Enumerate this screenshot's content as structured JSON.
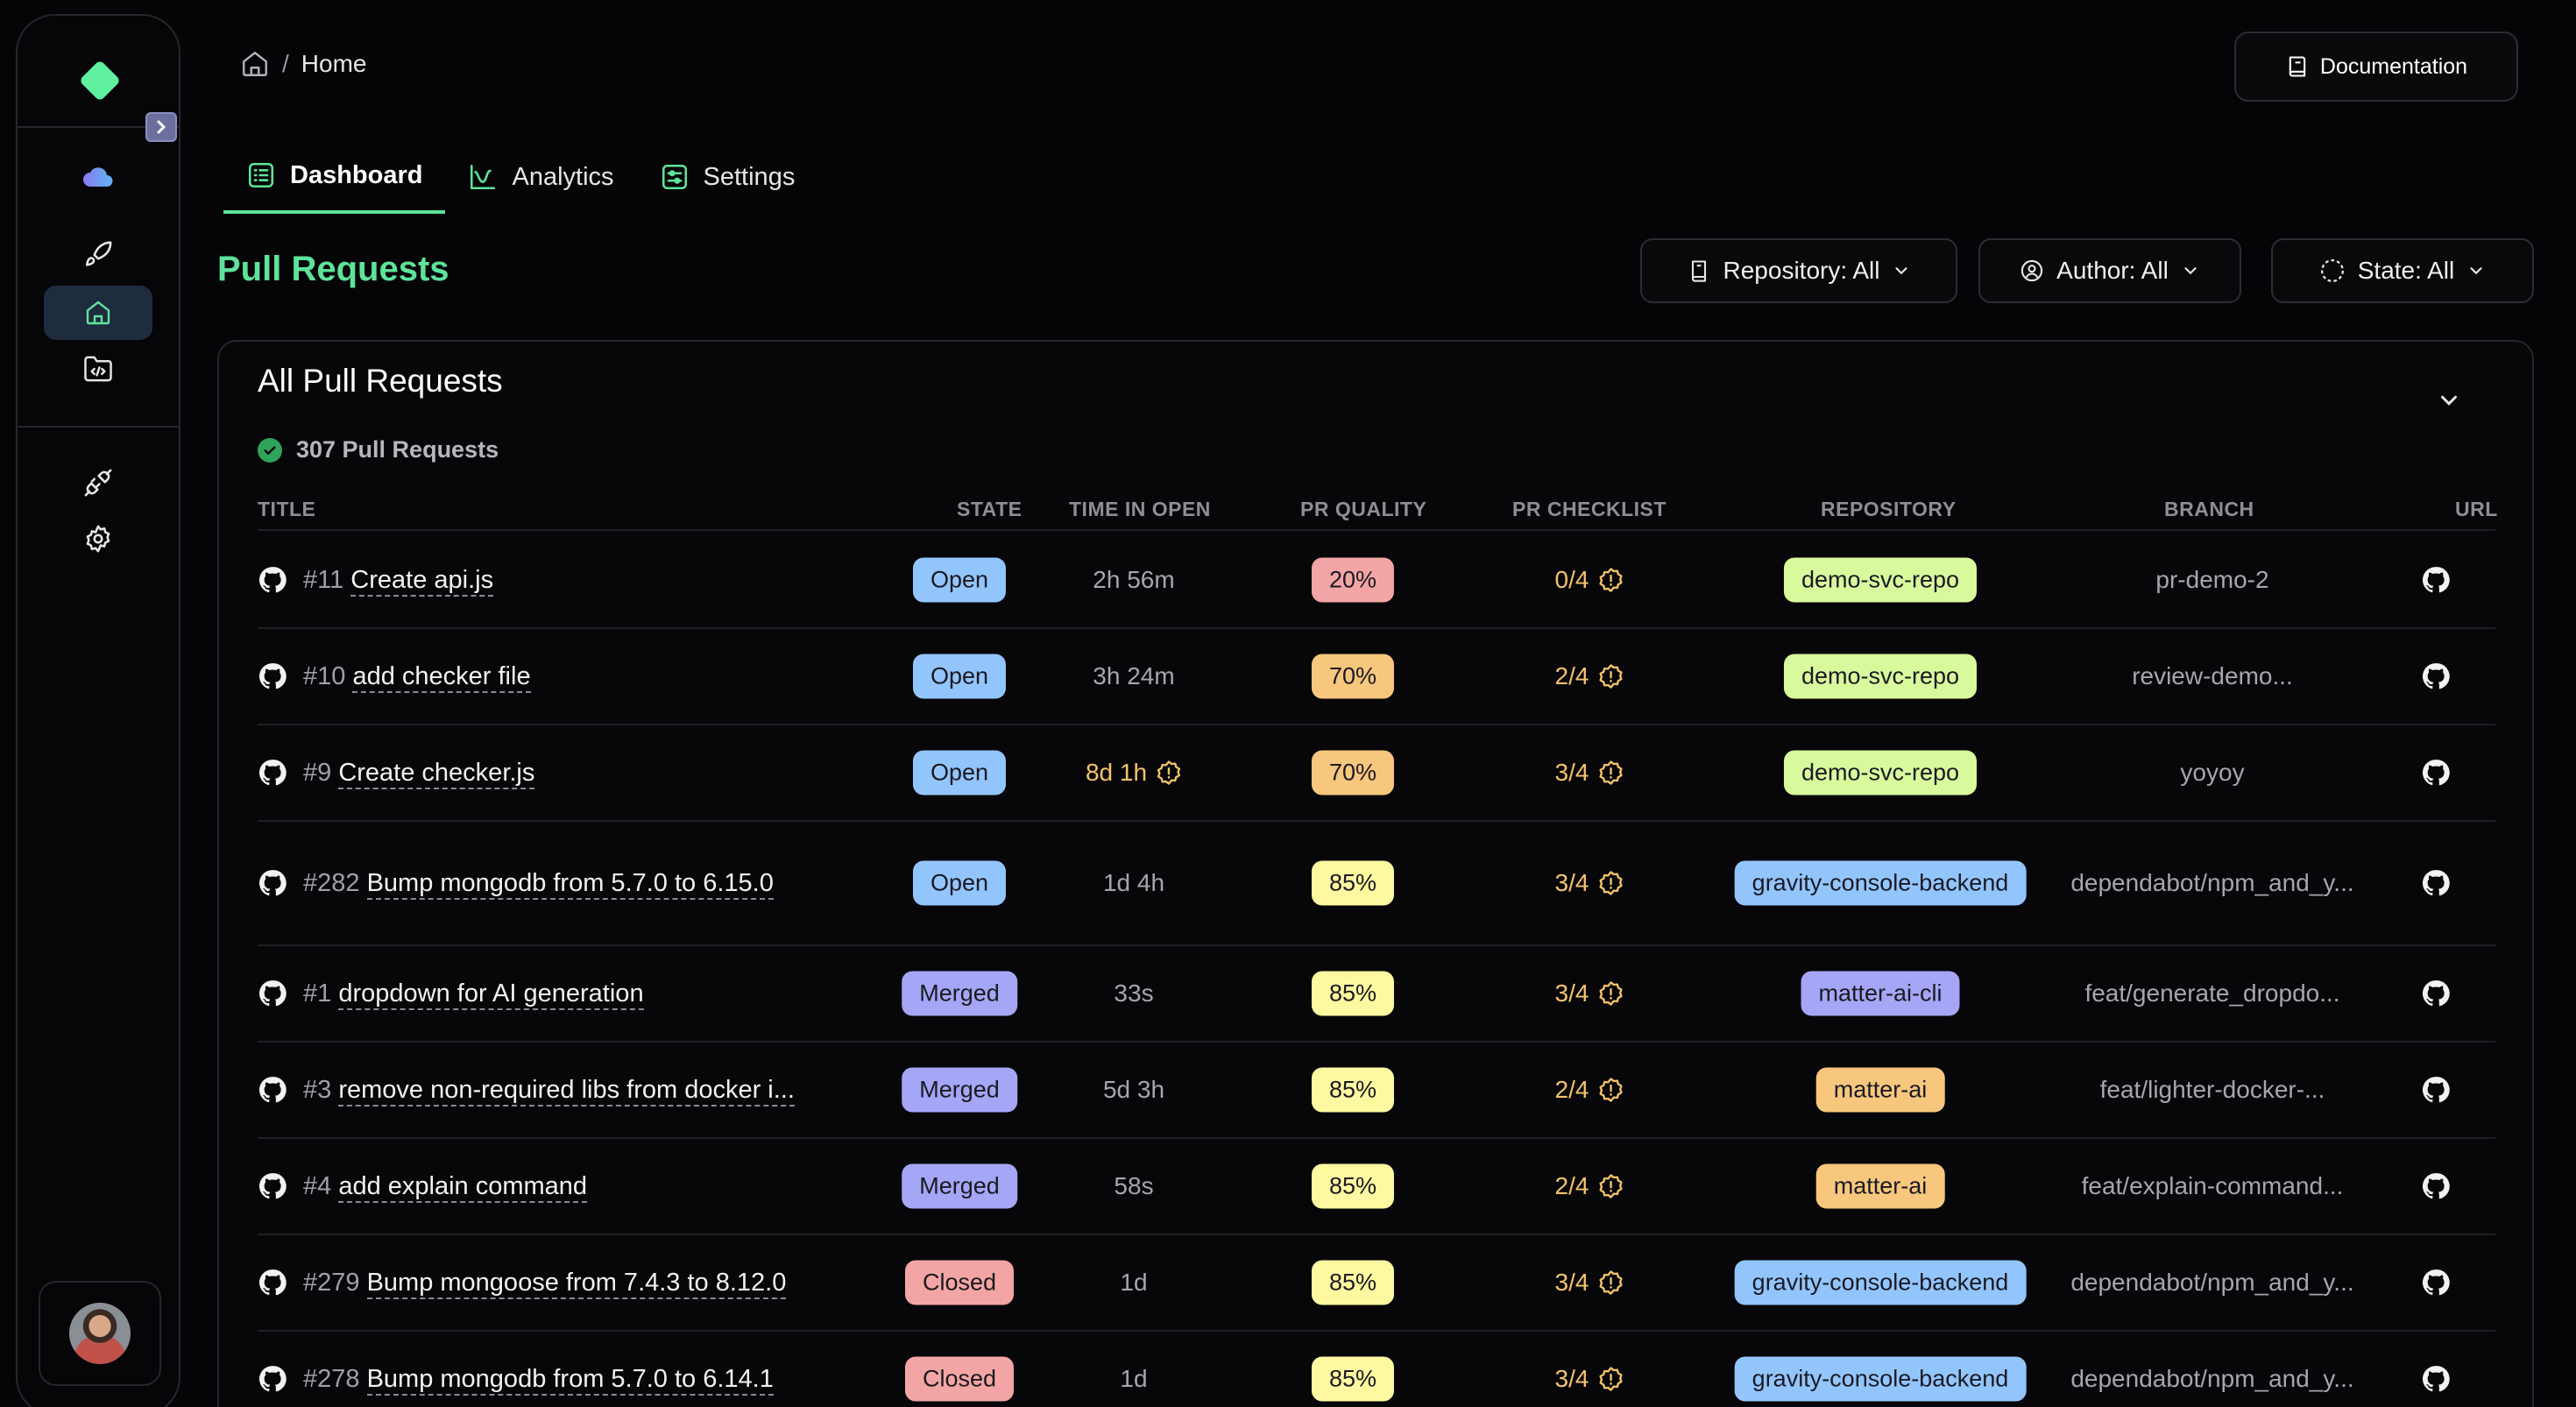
{
  "breadcrumb": {
    "current": "Home",
    "separator": "/"
  },
  "header": {
    "documentation_label": "Documentation"
  },
  "tabs": [
    {
      "label": "Dashboard",
      "active": true
    },
    {
      "label": "Analytics",
      "active": false
    },
    {
      "label": "Settings",
      "active": false
    }
  ],
  "page_title": "Pull Requests",
  "filters": {
    "repository": "Repository: All",
    "author": "Author: All",
    "state": "State: All"
  },
  "card": {
    "title": "All Pull Requests",
    "count_label": "307 Pull Requests"
  },
  "columns": [
    "TITLE",
    "STATE",
    "TIME IN OPEN",
    "PR QUALITY",
    "PR CHECKLIST",
    "REPOSITORY",
    "BRANCH",
    "URL"
  ],
  "colors": {
    "accent": "#5ee39a",
    "open": "#93c5fd",
    "merged": "#a5a6f6",
    "closed": "#f3a5a5",
    "quality_low": "#f3a5a5",
    "quality_mid": "#f8c77e",
    "quality_high": "#fef9a0",
    "repo_demo": "#d9f99d",
    "repo_gravity": "#93c5fd",
    "repo_matter_cli": "#a5a6f6",
    "repo_matter": "#f8c77e",
    "warning": "#f5c36b"
  },
  "rows": [
    {
      "num": "#11",
      "title": "Create api.js",
      "state": "Open",
      "time": "2h 56m",
      "time_warn": false,
      "quality": "20%",
      "checklist": "0/4",
      "repo": "demo-svc-repo",
      "branch": "pr-demo-2"
    },
    {
      "num": "#10",
      "title": "add checker file",
      "state": "Open",
      "time": "3h 24m",
      "time_warn": false,
      "quality": "70%",
      "checklist": "2/4",
      "repo": "demo-svc-repo",
      "branch": "review-demo..."
    },
    {
      "num": "#9",
      "title": "Create checker.js",
      "state": "Open",
      "time": "8d 1h",
      "time_warn": true,
      "quality": "70%",
      "checklist": "3/4",
      "repo": "demo-svc-repo",
      "branch": "yoyoy"
    },
    {
      "num": "#282",
      "title": "Bump mongodb from 5.7.0 to 6.15.0",
      "state": "Open",
      "time": "1d 4h",
      "time_warn": false,
      "quality": "85%",
      "checklist": "3/4",
      "repo": "gravity-console-backend",
      "branch": "dependabot/npm_and_y..."
    },
    {
      "num": "#1",
      "title": "dropdown for AI generation",
      "state": "Merged",
      "time": "33s",
      "time_warn": false,
      "quality": "85%",
      "checklist": "3/4",
      "repo": "matter-ai-cli",
      "branch": "feat/generate_dropdo..."
    },
    {
      "num": "#3",
      "title": "remove non-required libs from docker i...",
      "state": "Merged",
      "time": "5d 3h",
      "time_warn": false,
      "quality": "85%",
      "checklist": "2/4",
      "repo": "matter-ai",
      "branch": "feat/lighter-docker-..."
    },
    {
      "num": "#4",
      "title": "add explain command",
      "state": "Merged",
      "time": "58s",
      "time_warn": false,
      "quality": "85%",
      "checklist": "2/4",
      "repo": "matter-ai",
      "branch": "feat/explain-command..."
    },
    {
      "num": "#279",
      "title": "Bump mongoose from 7.4.3 to 8.12.0",
      "state": "Closed",
      "time": "1d",
      "time_warn": false,
      "quality": "85%",
      "checklist": "3/4",
      "repo": "gravity-console-backend",
      "branch": "dependabot/npm_and_y..."
    },
    {
      "num": "#278",
      "title": "Bump mongodb from 5.7.0 to 6.14.1",
      "state": "Closed",
      "time": "1d",
      "time_warn": false,
      "quality": "85%",
      "checklist": "3/4",
      "repo": "gravity-console-backend",
      "branch": "dependabot/npm_and_y..."
    }
  ]
}
